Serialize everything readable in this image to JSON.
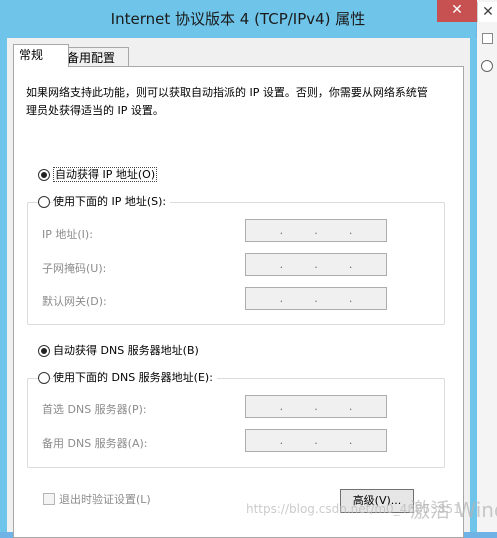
{
  "window": {
    "title": "Internet 协议版本 4 (TCP/IPv4) 属性",
    "close_glyph": "✕"
  },
  "tabs": [
    {
      "label": "常规",
      "selected": true
    },
    {
      "label": "备用配置",
      "selected": false
    }
  ],
  "description": "如果网络支持此功能，则可以获取自动指派的 IP 设置。否则，你需要从网络系统管理员处获得适当的 IP 设置。",
  "ip_section": {
    "auto_label": "自动获得 IP 地址(O)",
    "manual_label": "使用下面的 IP 地址(S):",
    "selected": "auto",
    "fields": [
      {
        "label": "IP 地址(I):",
        "value": ". . ."
      },
      {
        "label": "子网掩码(U):",
        "value": ". . ."
      },
      {
        "label": "默认网关(D):",
        "value": ". . ."
      }
    ]
  },
  "dns_section": {
    "auto_label": "自动获得 DNS 服务器地址(B)",
    "manual_label": "使用下面的 DNS 服务器地址(E):",
    "selected": "auto",
    "fields": [
      {
        "label": "首选 DNS 服务器(P):",
        "value": ". . ."
      },
      {
        "label": "备用 DNS 服务器(A):",
        "value": ". . ."
      }
    ]
  },
  "validate_label": "退出时验证设置(L)",
  "advanced_button": "高级(V)...",
  "watermark": "https://blog.csdn.net/m0_48853851",
  "watermark2": "激活 Wind",
  "icons": {
    "radio": "radio-icon",
    "checkbox": "checkbox-icon",
    "close": "close-icon"
  }
}
